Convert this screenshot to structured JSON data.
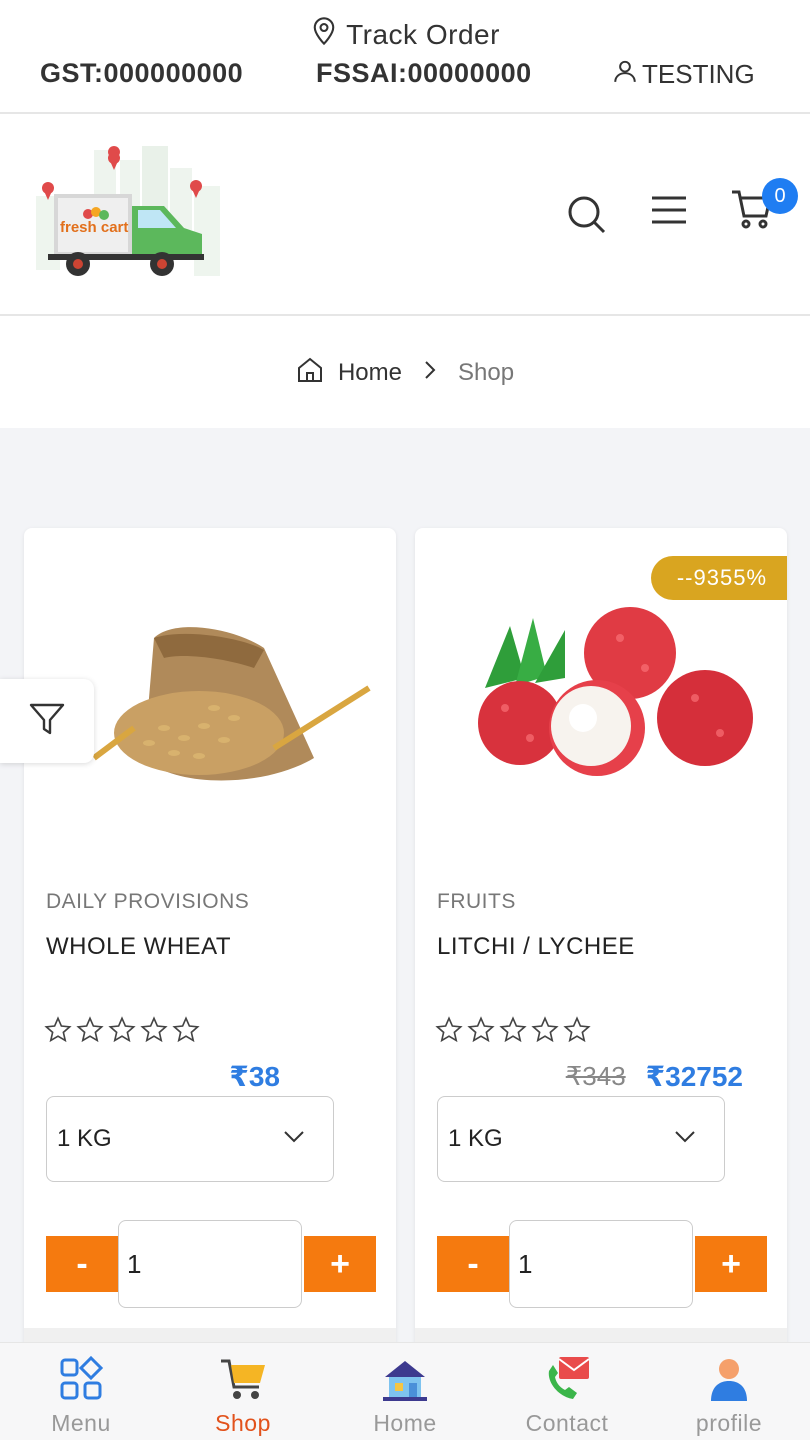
{
  "topbar": {
    "track_order": "Track Order",
    "gst": "GST:000000000",
    "fssai": "FSSAI:00000000",
    "user": "TESTING"
  },
  "header": {
    "logo_text": "fresh cart",
    "cart_count": "0"
  },
  "breadcrumb": {
    "home": "Home",
    "current": "Shop"
  },
  "products": [
    {
      "category": "DAILY PROVISIONS",
      "name": "WHOLE WHEAT",
      "rating": 0,
      "price": "₹38",
      "unit": "1 KG",
      "quantity": "1"
    },
    {
      "category": "FRUITS",
      "name": "LITCHI / LYCHEE",
      "discount": "--9355%",
      "rating": 0,
      "old_price": "₹343",
      "price": "₹32752",
      "unit": "1 KG",
      "quantity": "1"
    }
  ],
  "qty_buttons": {
    "minus": "-",
    "plus": "+"
  },
  "bottom_nav": [
    {
      "label": "Menu",
      "icon": "grid-icon",
      "active": false
    },
    {
      "label": "Shop",
      "icon": "shopping-cart-icon",
      "active": true
    },
    {
      "label": "Home",
      "icon": "house-icon",
      "active": false
    },
    {
      "label": "Contact",
      "icon": "contact-icon",
      "active": false
    },
    {
      "label": "profile",
      "icon": "profile-icon",
      "active": false
    }
  ],
  "colors": {
    "accent_orange": "#f57a0f",
    "price_blue": "#2f7de1",
    "badge_gold": "#d9a520",
    "cart_badge_blue": "#1f7df2",
    "active_nav": "#e2521c"
  }
}
